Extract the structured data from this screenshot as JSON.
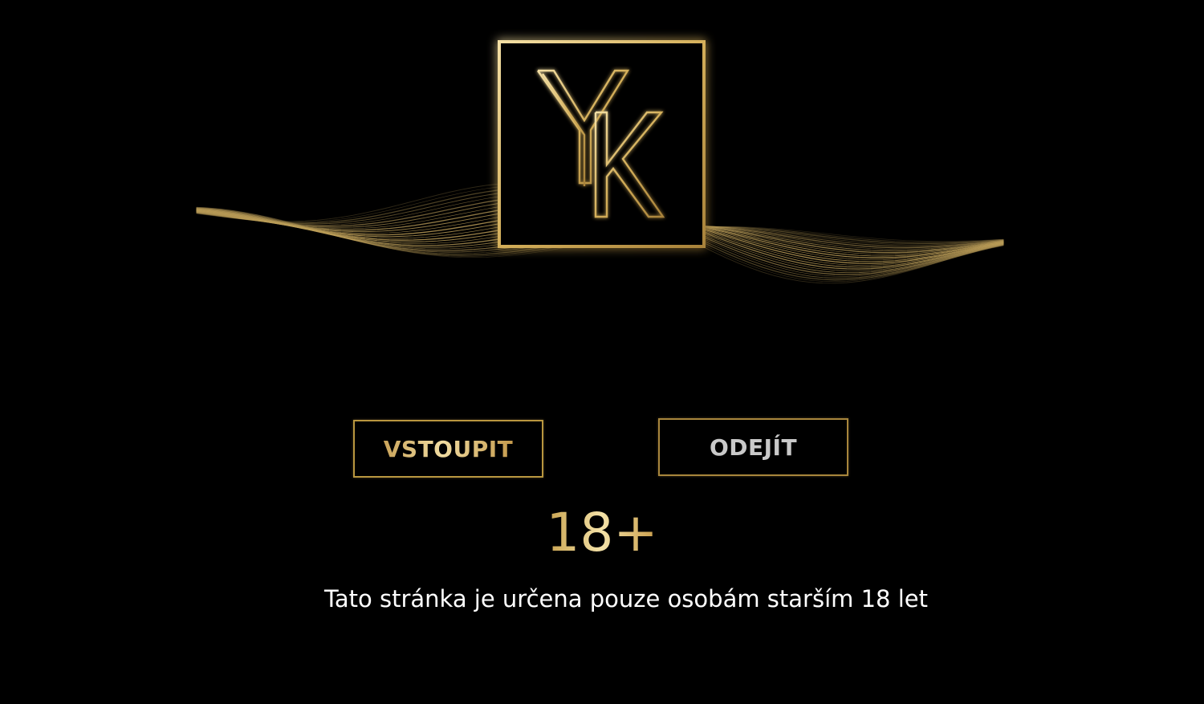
{
  "logo": {
    "monogram": "YK",
    "accent_color": "#d4af5a"
  },
  "actions": {
    "enter_label": "VSTOUPIT",
    "leave_label": "ODEJÍT"
  },
  "age_gate": {
    "badge": "18+",
    "notice": "Tato stránka je určena pouze osobám starším 18 let"
  },
  "colors": {
    "background": "#000000",
    "gold": "#d4af5a",
    "gold_light": "#f1dca1",
    "leave_text": "#c9c9c9",
    "notice_text": "#ffffff"
  }
}
